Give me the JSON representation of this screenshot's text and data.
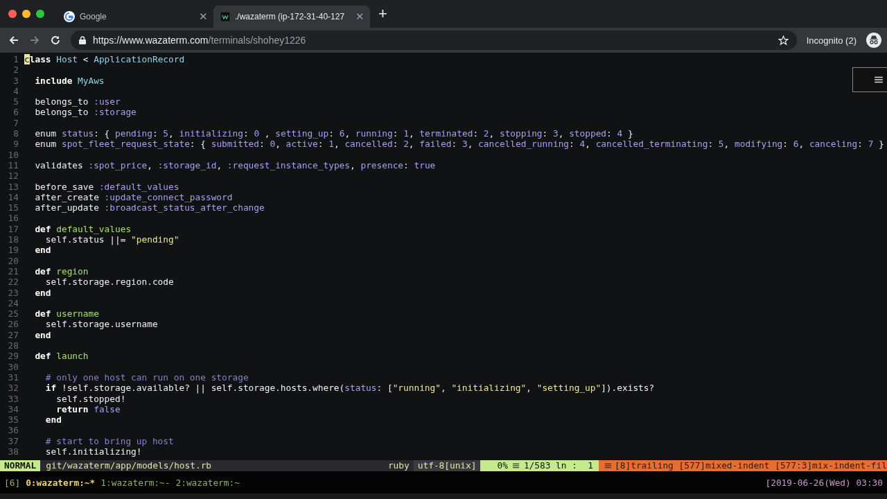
{
  "browser": {
    "tabs": [
      {
        "title": "Google",
        "close": "✕",
        "selected": false
      },
      {
        "title": "./wazaterm (ip-172-31-40-127",
        "close": "✕",
        "selected": true
      }
    ],
    "new_tab": "+",
    "url": {
      "host": "https://www.wazaterm.com",
      "path": "/terminals/shohey1226"
    },
    "profile": "Incognito (2)"
  },
  "editor": {
    "lines": [
      {
        "n": "1",
        "tokens": [
          {
            "kind": "cursor",
            "text": "c"
          },
          {
            "kind": "kw",
            "text": "lass "
          },
          {
            "kind": "type",
            "text": "Host"
          },
          {
            "kind": "plain",
            "text": " < "
          },
          {
            "kind": "type",
            "text": "ApplicationRecord"
          }
        ]
      },
      {
        "n": "2"
      },
      {
        "n": "3",
        "tokens": [
          {
            "kind": "kw",
            "text": "  include "
          },
          {
            "kind": "type",
            "text": "MyAws"
          }
        ]
      },
      {
        "n": "4"
      },
      {
        "n": "5",
        "tokens": [
          {
            "kind": "plain",
            "text": "  belongs_to "
          },
          {
            "kind": "const",
            "text": ":user"
          }
        ]
      },
      {
        "n": "6",
        "tokens": [
          {
            "kind": "plain",
            "text": "  belongs_to "
          },
          {
            "kind": "const",
            "text": ":storage"
          }
        ]
      },
      {
        "n": "7"
      },
      {
        "n": "8",
        "tokens": [
          {
            "kind": "plain",
            "text": "  enum "
          },
          {
            "kind": "const",
            "text": "status"
          },
          {
            "kind": "plain",
            "text": ": { "
          },
          {
            "kind": "const",
            "text": "pending"
          },
          {
            "kind": "plain",
            "text": ": "
          },
          {
            "kind": "const",
            "text": "5"
          },
          {
            "kind": "plain",
            "text": ", "
          },
          {
            "kind": "const",
            "text": "initializing"
          },
          {
            "kind": "plain",
            "text": ": "
          },
          {
            "kind": "const",
            "text": "0"
          },
          {
            "kind": "plain",
            "text": " , "
          },
          {
            "kind": "const",
            "text": "setting_up"
          },
          {
            "kind": "plain",
            "text": ": "
          },
          {
            "kind": "const",
            "text": "6"
          },
          {
            "kind": "plain",
            "text": ", "
          },
          {
            "kind": "const",
            "text": "running"
          },
          {
            "kind": "plain",
            "text": ": "
          },
          {
            "kind": "const",
            "text": "1"
          },
          {
            "kind": "plain",
            "text": ", "
          },
          {
            "kind": "const",
            "text": "terminated"
          },
          {
            "kind": "plain",
            "text": ": "
          },
          {
            "kind": "const",
            "text": "2"
          },
          {
            "kind": "plain",
            "text": ", "
          },
          {
            "kind": "const",
            "text": "stopping"
          },
          {
            "kind": "plain",
            "text": ": "
          },
          {
            "kind": "const",
            "text": "3"
          },
          {
            "kind": "plain",
            "text": ", "
          },
          {
            "kind": "const",
            "text": "stopped"
          },
          {
            "kind": "plain",
            "text": ": "
          },
          {
            "kind": "const",
            "text": "4"
          },
          {
            "kind": "plain",
            "text": " }"
          }
        ]
      },
      {
        "n": "9",
        "tokens": [
          {
            "kind": "plain",
            "text": "  enum "
          },
          {
            "kind": "const",
            "text": "spot_fleet_request_state"
          },
          {
            "kind": "plain",
            "text": ": { "
          },
          {
            "kind": "const",
            "text": "submitted"
          },
          {
            "kind": "plain",
            "text": ": "
          },
          {
            "kind": "const",
            "text": "0"
          },
          {
            "kind": "plain",
            "text": ", "
          },
          {
            "kind": "const",
            "text": "active"
          },
          {
            "kind": "plain",
            "text": ": "
          },
          {
            "kind": "const",
            "text": "1"
          },
          {
            "kind": "plain",
            "text": ", "
          },
          {
            "kind": "const",
            "text": "cancelled"
          },
          {
            "kind": "plain",
            "text": ": "
          },
          {
            "kind": "const",
            "text": "2"
          },
          {
            "kind": "plain",
            "text": ", "
          },
          {
            "kind": "const",
            "text": "failed"
          },
          {
            "kind": "plain",
            "text": ": "
          },
          {
            "kind": "const",
            "text": "3"
          },
          {
            "kind": "plain",
            "text": ", "
          },
          {
            "kind": "const",
            "text": "cancelled_running"
          },
          {
            "kind": "plain",
            "text": ": "
          },
          {
            "kind": "const",
            "text": "4"
          },
          {
            "kind": "plain",
            "text": ", "
          },
          {
            "kind": "const",
            "text": "cancelled_terminating"
          },
          {
            "kind": "plain",
            "text": ": "
          },
          {
            "kind": "const",
            "text": "5"
          },
          {
            "kind": "plain",
            "text": ", "
          },
          {
            "kind": "const",
            "text": "modifying"
          },
          {
            "kind": "plain",
            "text": ": "
          },
          {
            "kind": "const",
            "text": "6"
          },
          {
            "kind": "plain",
            "text": ", "
          },
          {
            "kind": "const",
            "text": "canceling"
          },
          {
            "kind": "plain",
            "text": ": "
          },
          {
            "kind": "const",
            "text": "7"
          },
          {
            "kind": "plain",
            "text": " }"
          }
        ]
      },
      {
        "n": "10"
      },
      {
        "n": "11",
        "tokens": [
          {
            "kind": "plain",
            "text": "  validates "
          },
          {
            "kind": "const",
            "text": ":spot_price"
          },
          {
            "kind": "plain",
            "text": ", "
          },
          {
            "kind": "const",
            "text": ":storage_id"
          },
          {
            "kind": "plain",
            "text": ", "
          },
          {
            "kind": "const",
            "text": ":request_instance_types"
          },
          {
            "kind": "plain",
            "text": ", "
          },
          {
            "kind": "const",
            "text": "presence"
          },
          {
            "kind": "plain",
            "text": ": "
          },
          {
            "kind": "const",
            "text": "true"
          }
        ]
      },
      {
        "n": "12"
      },
      {
        "n": "13",
        "tokens": [
          {
            "kind": "plain",
            "text": "  before_save "
          },
          {
            "kind": "const",
            "text": ":default_values"
          }
        ]
      },
      {
        "n": "14",
        "tokens": [
          {
            "kind": "plain",
            "text": "  after_create "
          },
          {
            "kind": "const",
            "text": ":update_connect_password"
          }
        ]
      },
      {
        "n": "15",
        "tokens": [
          {
            "kind": "plain",
            "text": "  after_update "
          },
          {
            "kind": "const",
            "text": ":broadcast_status_after_change"
          }
        ]
      },
      {
        "n": "16"
      },
      {
        "n": "17",
        "tokens": [
          {
            "kind": "kw",
            "text": "  def "
          },
          {
            "kind": "func",
            "text": "default_values"
          }
        ]
      },
      {
        "n": "18",
        "tokens": [
          {
            "kind": "plain",
            "text": "    self.status ||= "
          },
          {
            "kind": "str",
            "text": "\"pending\""
          }
        ]
      },
      {
        "n": "19",
        "tokens": [
          {
            "kind": "kw",
            "text": "  end"
          }
        ]
      },
      {
        "n": "20"
      },
      {
        "n": "21",
        "tokens": [
          {
            "kind": "kw",
            "text": "  def "
          },
          {
            "kind": "func",
            "text": "region"
          }
        ]
      },
      {
        "n": "22",
        "tokens": [
          {
            "kind": "plain",
            "text": "    self.storage.region.code"
          }
        ]
      },
      {
        "n": "23",
        "tokens": [
          {
            "kind": "kw",
            "text": "  end"
          }
        ]
      },
      {
        "n": "24"
      },
      {
        "n": "25",
        "tokens": [
          {
            "kind": "kw",
            "text": "  def "
          },
          {
            "kind": "func",
            "text": "username"
          }
        ]
      },
      {
        "n": "26",
        "tokens": [
          {
            "kind": "plain",
            "text": "    self.storage.username"
          }
        ]
      },
      {
        "n": "27",
        "tokens": [
          {
            "kind": "kw",
            "text": "  end"
          }
        ]
      },
      {
        "n": "28"
      },
      {
        "n": "29",
        "tokens": [
          {
            "kind": "kw",
            "text": "  def "
          },
          {
            "kind": "func",
            "text": "launch"
          }
        ]
      },
      {
        "n": "30"
      },
      {
        "n": "31",
        "tokens": [
          {
            "kind": "comment",
            "text": "    # only one host can run on one storage"
          }
        ]
      },
      {
        "n": "32",
        "tokens": [
          {
            "kind": "kw",
            "text": "    if "
          },
          {
            "kind": "plain",
            "text": "!self.storage.available? || self.storage.hosts.where("
          },
          {
            "kind": "const",
            "text": "status"
          },
          {
            "kind": "plain",
            "text": ": ["
          },
          {
            "kind": "str",
            "text": "\"running\""
          },
          {
            "kind": "plain",
            "text": ", "
          },
          {
            "kind": "str",
            "text": "\"initializing\""
          },
          {
            "kind": "plain",
            "text": ", "
          },
          {
            "kind": "str",
            "text": "\"setting_up\""
          },
          {
            "kind": "plain",
            "text": "]).exists?"
          }
        ]
      },
      {
        "n": "33",
        "tokens": [
          {
            "kind": "plain",
            "text": "      self.stopped!"
          }
        ]
      },
      {
        "n": "34",
        "tokens": [
          {
            "kind": "kw",
            "text": "      return "
          },
          {
            "kind": "const",
            "text": "false"
          }
        ]
      },
      {
        "n": "35",
        "tokens": [
          {
            "kind": "kw",
            "text": "    end"
          }
        ]
      },
      {
        "n": "36"
      },
      {
        "n": "37",
        "tokens": [
          {
            "kind": "comment",
            "text": "    # start to bring up host"
          }
        ]
      },
      {
        "n": "38",
        "tokens": [
          {
            "kind": "plain",
            "text": "    self.initializing!"
          }
        ]
      }
    ]
  },
  "statusline": {
    "mode": "NORMAL",
    "path": "git/wazaterm/app/models/host.rb",
    "filetype": "ruby",
    "encoding": "utf-8[unix]",
    "percent": "0%",
    "position": "1/583 ln :  1",
    "warnings": "[8]trailing [577]mixed-indent [577:3]mix-indent-fil"
  },
  "tmux": {
    "session": "[6]",
    "windows": [
      {
        "label": "0:wazaterm:~*",
        "selected": true
      },
      {
        "label": "1:wazaterm:~-",
        "selected": false
      },
      {
        "label": "2:wazaterm:~",
        "selected": false
      }
    ],
    "clock": "[2019-06-26(Wed) 03:30"
  }
}
